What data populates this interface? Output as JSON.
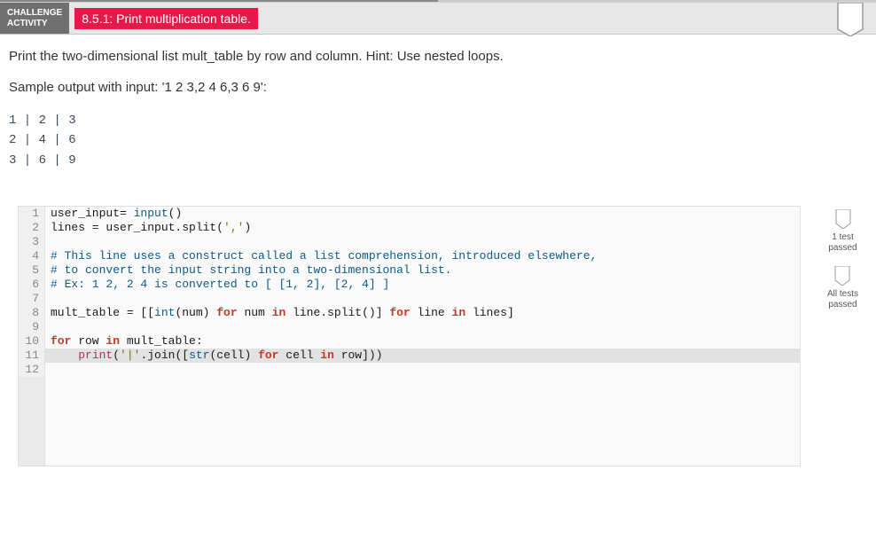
{
  "header": {
    "label_line1": "CHALLENGE",
    "label_line2": "ACTIVITY",
    "title": "8.5.1: Print multiplication table."
  },
  "instruction": "Print the two-dimensional list mult_table by row and column. Hint: Use nested loops.",
  "sample_label": "Sample output with input: '1 2 3,2 4 6,3 6 9':",
  "sample_output": "1 | 2 | 3\n2 | 4 | 6\n3 | 6 | 9",
  "code_lines": [
    {
      "n": "1",
      "segs": [
        [
          "ident",
          "user_input"
        ],
        [
          "ident",
          "= "
        ],
        [
          "builtin",
          "input"
        ],
        [
          "ident",
          "()"
        ]
      ]
    },
    {
      "n": "2",
      "segs": [
        [
          "ident",
          "lines = user_input.split("
        ],
        [
          "str",
          "','"
        ],
        [
          "ident",
          ")"
        ]
      ]
    },
    {
      "n": "3",
      "segs": []
    },
    {
      "n": "4",
      "segs": [
        [
          "comment",
          "# This line uses a construct called a list comprehension, introduced elsewhere,"
        ]
      ]
    },
    {
      "n": "5",
      "segs": [
        [
          "comment",
          "# to convert the input string into a two-dimensional list."
        ]
      ]
    },
    {
      "n": "6",
      "segs": [
        [
          "comment",
          "# Ex: 1 2, 2 4 is converted to [ [1, 2], [2, 4] ]"
        ]
      ]
    },
    {
      "n": "7",
      "segs": []
    },
    {
      "n": "8",
      "segs": [
        [
          "ident",
          "mult_table = [["
        ],
        [
          "builtin",
          "int"
        ],
        [
          "ident",
          "(num) "
        ],
        [
          "kw",
          "for"
        ],
        [
          "ident",
          " num "
        ],
        [
          "kw",
          "in"
        ],
        [
          "ident",
          " line.split()] "
        ],
        [
          "kw",
          "for"
        ],
        [
          "ident",
          " line "
        ],
        [
          "kw",
          "in"
        ],
        [
          "ident",
          " lines]"
        ]
      ]
    },
    {
      "n": "9",
      "segs": []
    },
    {
      "n": "10",
      "segs": [
        [
          "kw",
          "for"
        ],
        [
          "ident",
          " row "
        ],
        [
          "kw",
          "in"
        ],
        [
          "ident",
          " mult_table:"
        ]
      ]
    },
    {
      "n": "11",
      "hl": true,
      "segs": [
        [
          "ident",
          "    "
        ],
        [
          "func",
          "print"
        ],
        [
          "ident",
          "("
        ],
        [
          "str",
          "'|'"
        ],
        [
          "ident",
          ".join(["
        ],
        [
          "builtin",
          "str"
        ],
        [
          "ident",
          "(cell) "
        ],
        [
          "kw",
          "for"
        ],
        [
          "ident",
          " cell "
        ],
        [
          "kw",
          "in"
        ],
        [
          "ident",
          " row]))"
        ]
      ]
    },
    {
      "n": "12",
      "segs": []
    }
  ],
  "status": {
    "one_test": "1 test\npassed",
    "all_tests": "All tests\npassed"
  }
}
